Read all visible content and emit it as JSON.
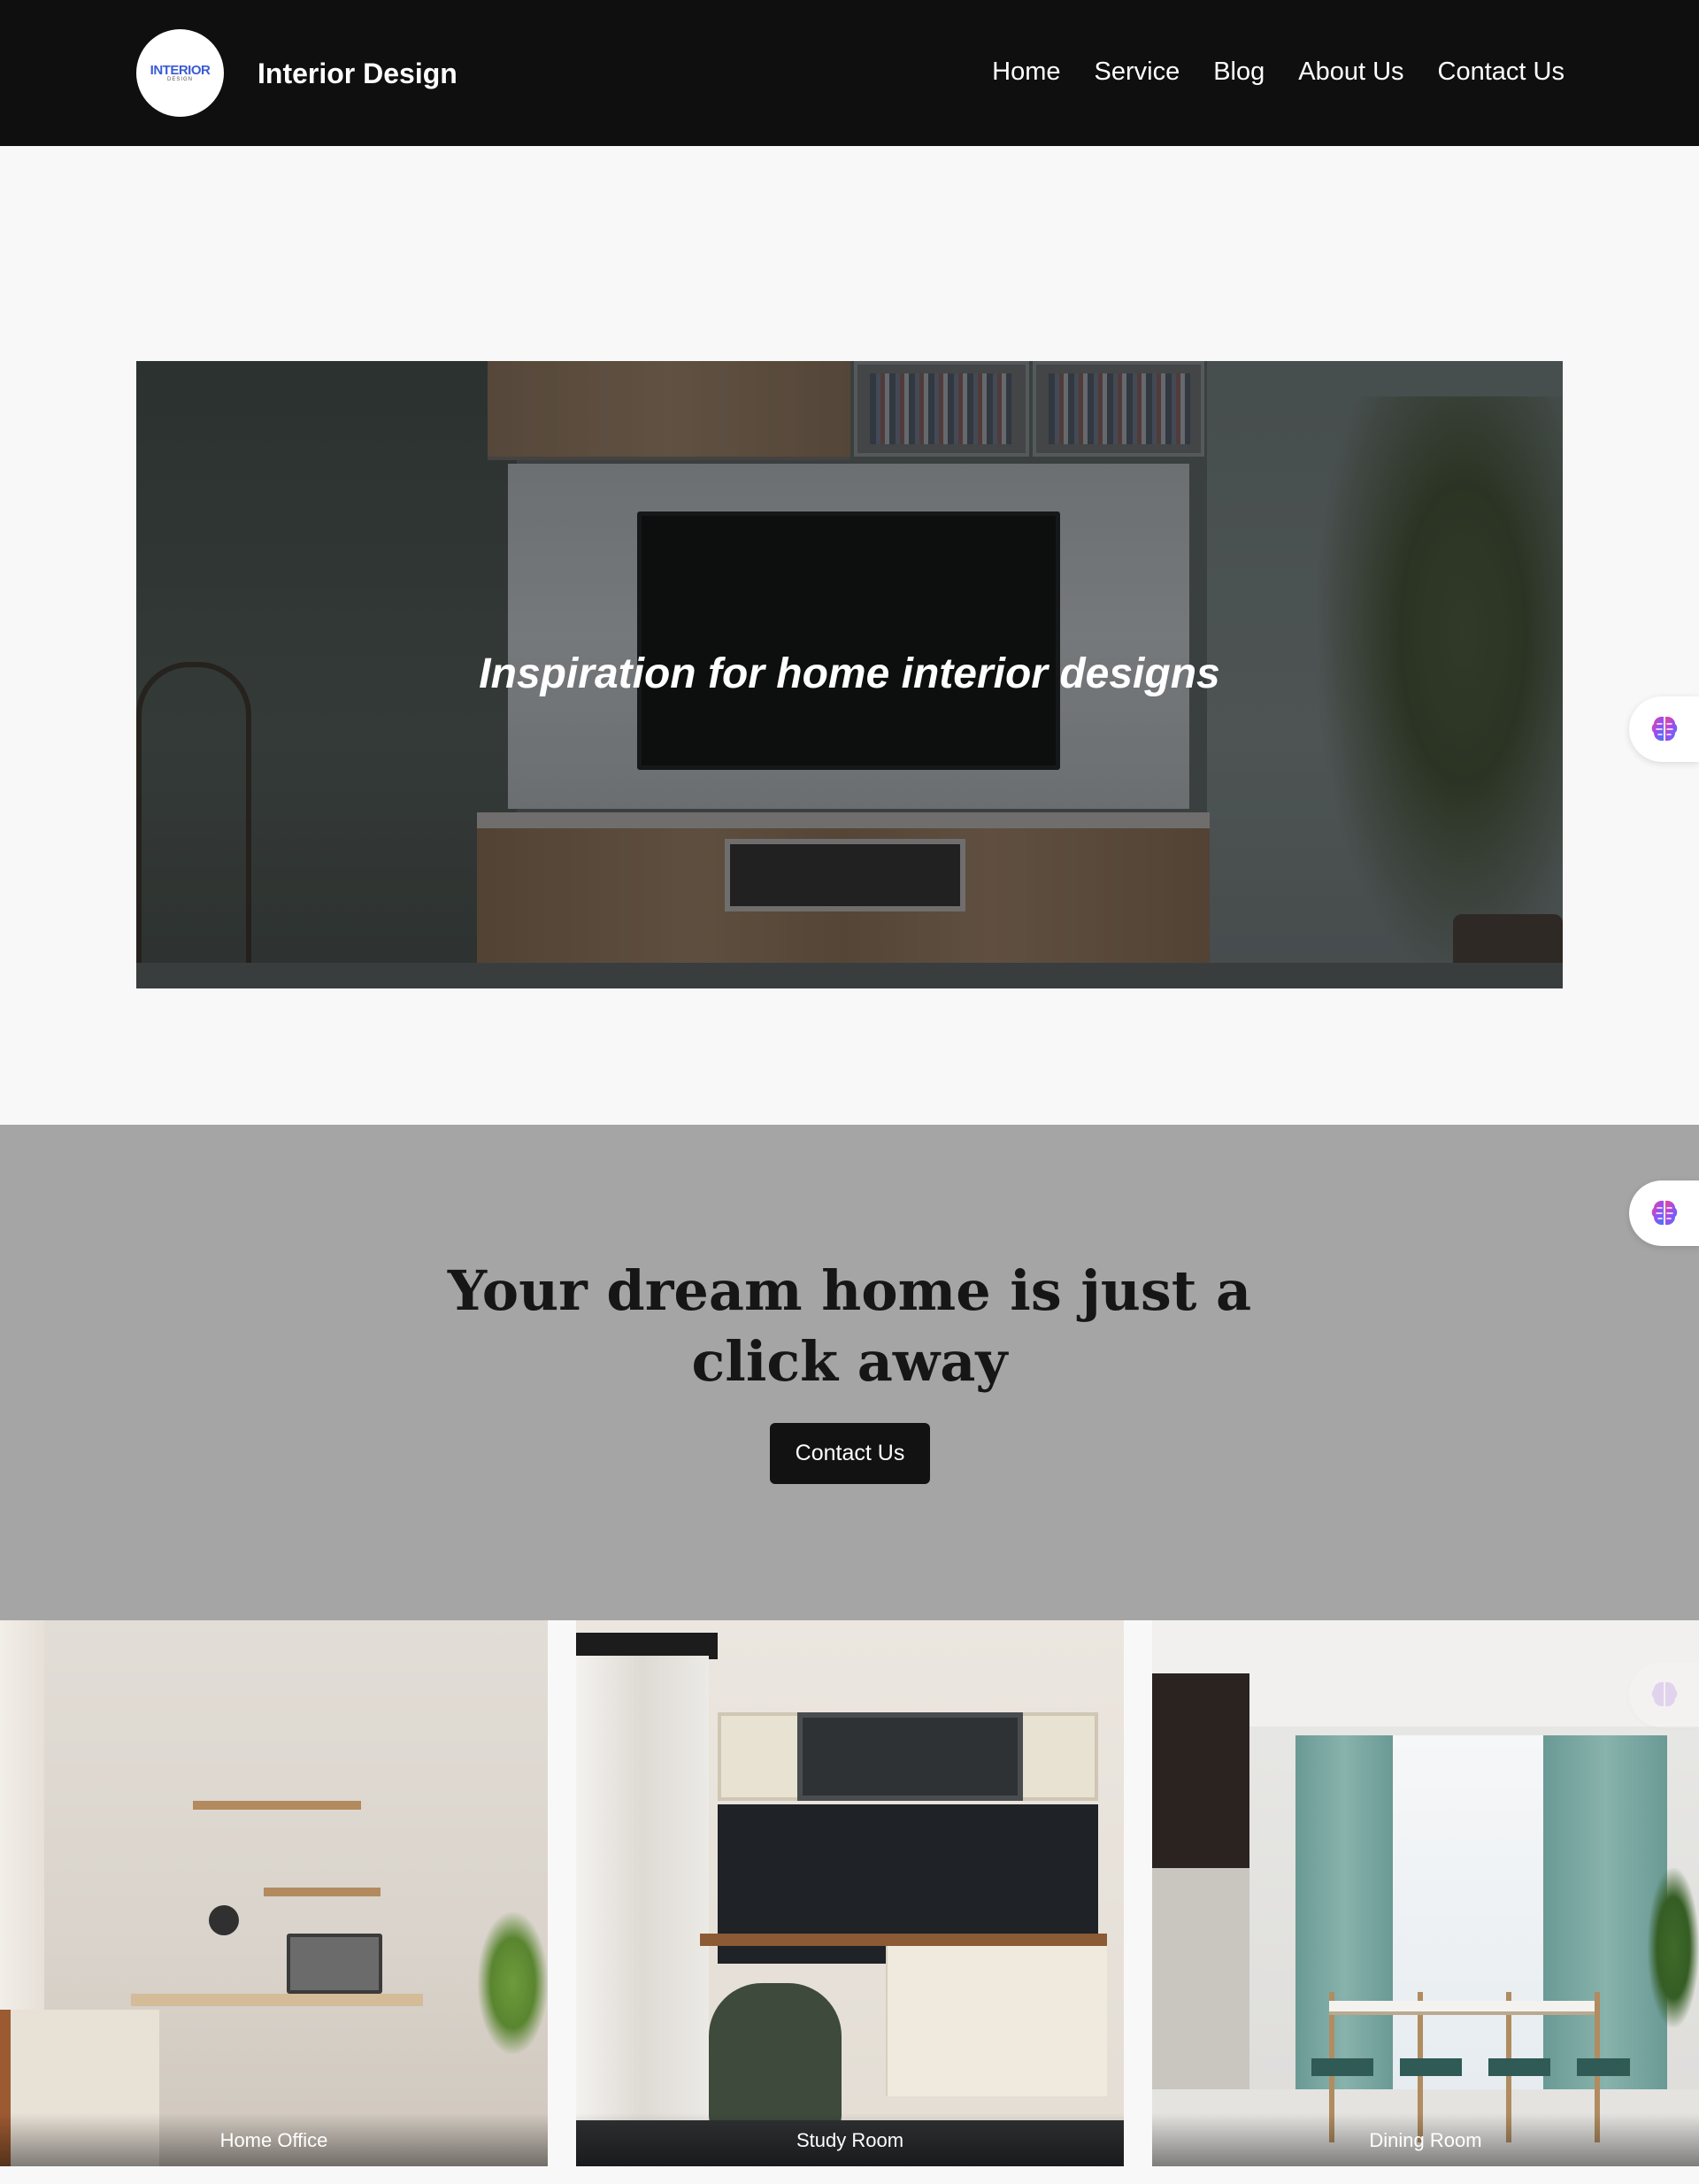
{
  "header": {
    "logo_text": "INTERIOR",
    "logo_subtext": "DESIGN",
    "brand": "Interior Design",
    "nav": [
      "Home",
      "Service",
      "Blog",
      "About Us",
      "Contact Us"
    ]
  },
  "hero": {
    "title": "Inspiration for home interior designs"
  },
  "cta": {
    "title": "Your dream home is just a click away",
    "button": "Contact Us"
  },
  "gallery": [
    {
      "label": "Home Office"
    },
    {
      "label": "Study Room"
    },
    {
      "label": "Dining Room"
    }
  ],
  "widget": {
    "icon": "brain-icon"
  },
  "colors": {
    "header_bg": "#0f0f10",
    "page_bg": "#f8f8f8",
    "cta_bg": "#a5a5a5",
    "button_bg": "#121212",
    "logo_accent": "#3a5bd6"
  }
}
